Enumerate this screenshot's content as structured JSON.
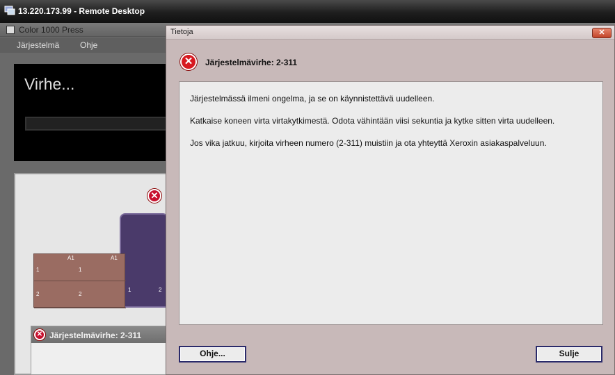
{
  "remote_desktop": {
    "title": "13.220.173.99 - Remote Desktop"
  },
  "app": {
    "title": "Color 1000 Press",
    "menu": [
      "Järjestelmä",
      "Ohje"
    ],
    "banner_text": "Virhe...",
    "tray_labels": [
      "1",
      "2",
      "1",
      "2"
    ],
    "tray_tags": [
      "A1",
      "A1"
    ],
    "tower_labels": [
      "1",
      "2"
    ],
    "sub_dialog_title": "Järjestelmävirhe: 2-311"
  },
  "dialog": {
    "title": "Tietoja",
    "heading": "Järjestelmävirhe: 2-311",
    "lines": [
      "Järjestelmässä ilmeni ongelma, ja se on käynnistettävä uudelleen.",
      "Katkaise koneen virta virtakytkimestä.  Odota vähintään viisi sekuntia ja kytke sitten virta uudelleen.",
      "Jos vika jatkuu, kirjoita virheen numero (2-311) muistiin ja ota yhteyttä Xeroxin asiakaspalveluun."
    ],
    "help_button": "Ohje...",
    "close_button": "Sulje"
  },
  "colors": {
    "dialog_bg": "#c8b9b9",
    "error_red": "#d71920"
  }
}
